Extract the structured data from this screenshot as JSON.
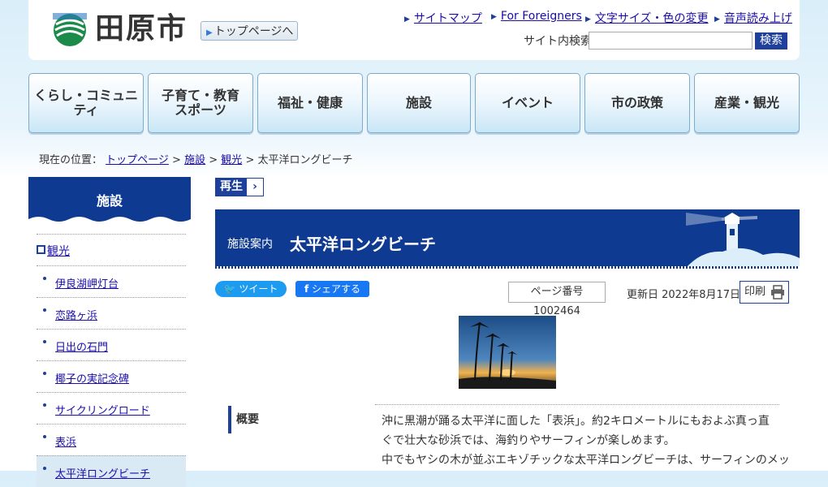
{
  "header": {
    "logo_text": "田原市",
    "top_button": "トップページへ",
    "utility_links": [
      "サイトマップ",
      "For Foreigners",
      "文字サイズ・色の変更",
      "音声読み上げ"
    ],
    "search_label": "サイト内検索",
    "search_placeholder": "",
    "search_button": "検索"
  },
  "global_nav": [
    {
      "line1": "くらし・コミュニティ",
      "line2": ""
    },
    {
      "line1": "子育て・教育",
      "line2": "スポーツ"
    },
    {
      "line1": "福祉・健康",
      "line2": ""
    },
    {
      "line1": "施設",
      "line2": ""
    },
    {
      "line1": "イベント",
      "line2": ""
    },
    {
      "line1": "市の政策",
      "line2": ""
    },
    {
      "line1": "産業・観光",
      "line2": ""
    }
  ],
  "breadcrumb": {
    "prefix": "現在の位置：",
    "items": [
      "トップページ",
      "施設",
      "観光"
    ],
    "separator": ">",
    "current": "太平洋ロングビーチ"
  },
  "sidebar": {
    "title": "施設",
    "category": "観光",
    "items": [
      "伊良湖岬灯台",
      "恋路ヶ浜",
      "日出の石門",
      "椰子の実記念碑",
      "サイクリングロード",
      "表浜",
      "太平洋ロングビーチ"
    ]
  },
  "play_button": {
    "label": "再生"
  },
  "page": {
    "category": "施設案内",
    "title": "太平洋ロングビーチ",
    "tweet": "ツイート",
    "share": "シェアする",
    "page_number": "ページ番号1002464",
    "updated": "更新日 2022年8月17日",
    "print": "印刷"
  },
  "summary": {
    "label": "概要",
    "text1": "沖に黒潮が踊る太平洋に面した「表浜」。約2キロメートルにもおよぶ真っ直ぐで壮大な砂浜では、海釣りやサーフィンが楽しめます。",
    "text2": "中でもヤシの木が並ぶエキゾチックな太平洋ロングビーチは、サーフィンのメッ"
  },
  "colors": {
    "brand": "#0f3a91",
    "link": "#1a0dab",
    "nav_accent": "#7faac9"
  }
}
